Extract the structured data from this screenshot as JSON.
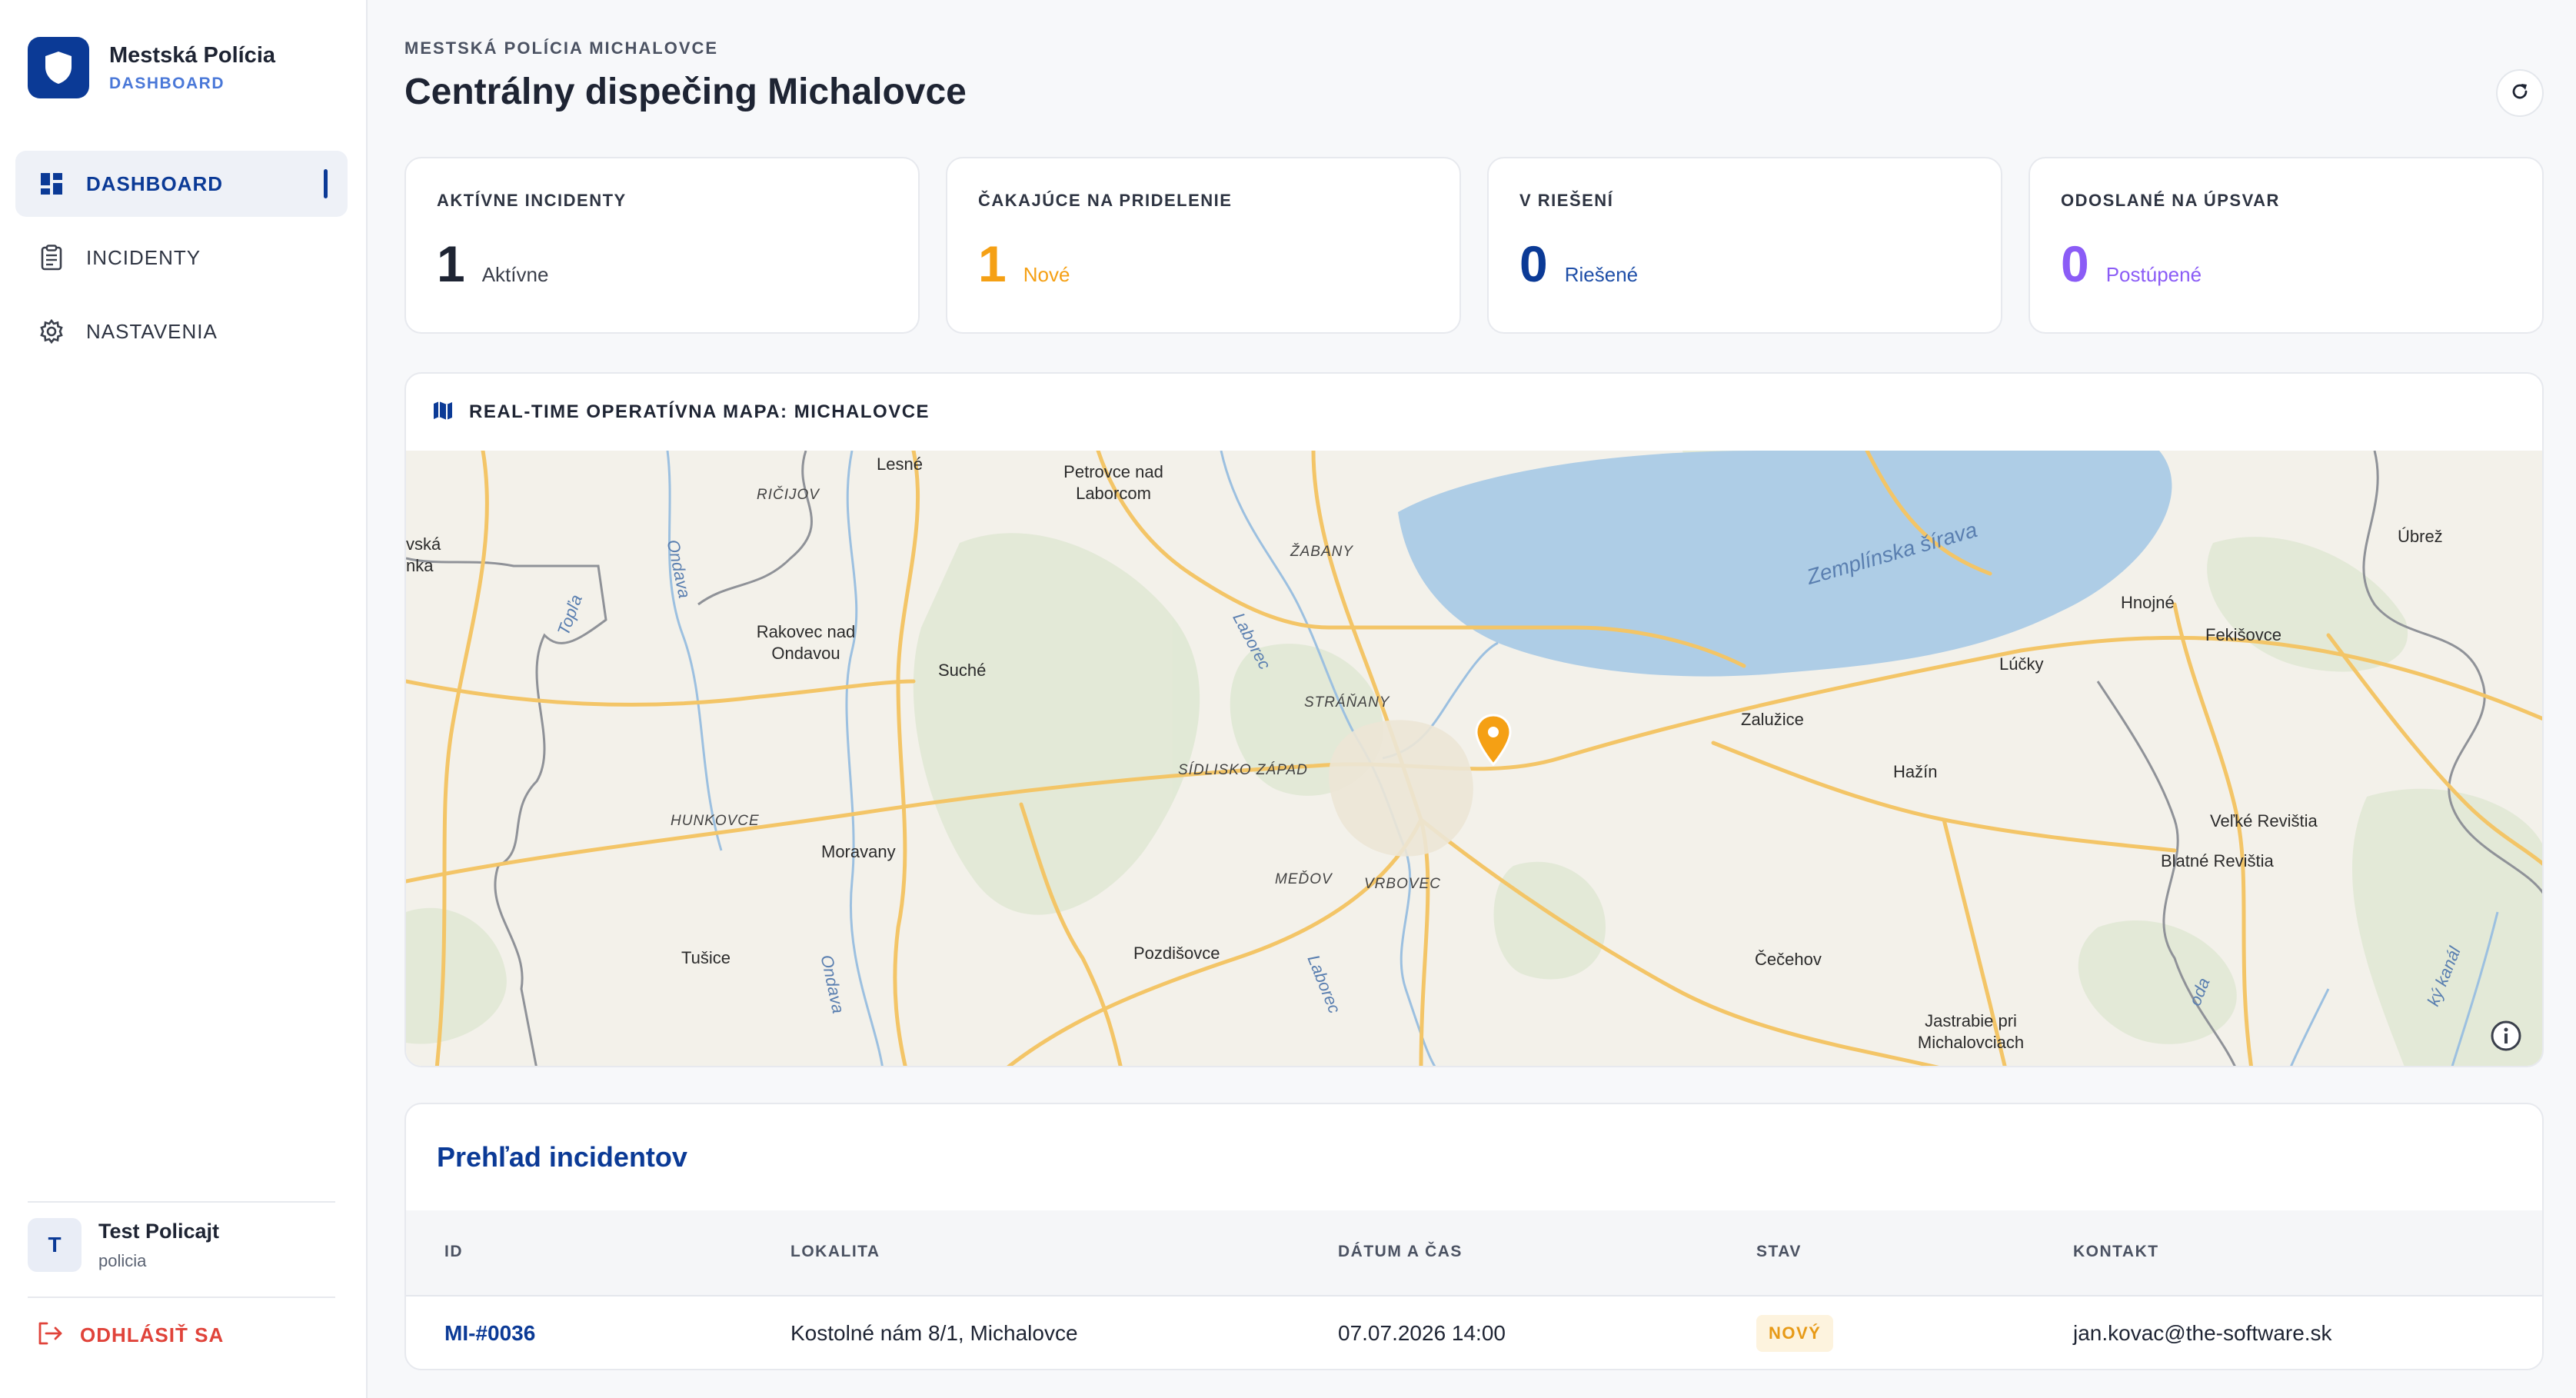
{
  "sidebar": {
    "brand_title": "Mestská Polícia",
    "brand_subtitle": "DASHBOARD",
    "items": [
      {
        "label": "DASHBOARD",
        "icon": "grid-icon",
        "active": true
      },
      {
        "label": "INCIDENTY",
        "icon": "clipboard-icon",
        "active": false
      },
      {
        "label": "NASTAVENIA",
        "icon": "gear-icon",
        "active": false
      }
    ],
    "user": {
      "initial": "T",
      "name": "Test Policajt",
      "role": "policia"
    },
    "logout_label": "ODHLÁSIŤ SA"
  },
  "header": {
    "eyebrow": "MESTSKÁ POLÍCIA MICHALOVCE",
    "title": "Centrálny dispečing Michalovce",
    "refresh_icon": "refresh-icon"
  },
  "stats": [
    {
      "label": "AKTÍVNE INCIDENTY",
      "value": "1",
      "unit": "Aktívne",
      "color": "#1e2433",
      "unit_color": "#3a3f4b"
    },
    {
      "label": "ČAKAJÚCE NA PRIDELENIE",
      "value": "1",
      "unit": "Nové",
      "color": "#f5a014",
      "unit_color": "#f5a014"
    },
    {
      "label": "V RIEŠENÍ",
      "value": "0",
      "unit": "Riešené",
      "color": "#0b3a96",
      "unit_color": "#1f4fa8"
    },
    {
      "label": "ODOSLANÉ NA ÚPSVAR",
      "value": "0",
      "unit": "Postúpené",
      "color": "#8b5cf6",
      "unit_color": "#8b5cf6"
    }
  ],
  "map": {
    "title": "REAL-TIME OPERATÍVNA MAPA: MICHALOVCE",
    "icon": "map-icon",
    "places": [
      "Lesné",
      "RIČIJOV",
      "Petrovce nad Laborcom",
      "ŽABANY",
      "vská nka",
      "Ondava",
      "Topľa",
      "Rakovec nad Ondavou",
      "Suché",
      "Laborec",
      "STRÁŇANY",
      "SÍDLISKO ZÁPAD",
      "HUNKOVCE",
      "Moravany",
      "MEĎOV",
      "VRBOVEC",
      "Tušice",
      "Ondava",
      "Pozdišovce",
      "Laborec",
      "Zemplínska šírava",
      "Zalužice",
      "Hažín",
      "Čečehov",
      "Jastrabie pri Michalovciach",
      "Úbrež",
      "Hnojné",
      "Fekišovce",
      "Lúčky",
      "Veľké Revištia",
      "Blatné Revištia",
      "oda",
      "ký kanál"
    ]
  },
  "incidents": {
    "title": "Prehľad incidentov",
    "columns": [
      "ID",
      "LOKALITA",
      "DÁTUM A ČAS",
      "STAV",
      "KONTAKT"
    ],
    "rows": [
      {
        "id": "MI-#0036",
        "location": "Kostolné nám 8/1, Michalovce",
        "datetime": "07.07.2026 14:00",
        "status": "NOVÝ",
        "contact": "jan.kovac@the-software.sk"
      }
    ]
  },
  "colors": {
    "accent": "#0b3a96",
    "warning": "#f5a014",
    "danger": "#e0433a",
    "violet": "#8b5cf6"
  }
}
